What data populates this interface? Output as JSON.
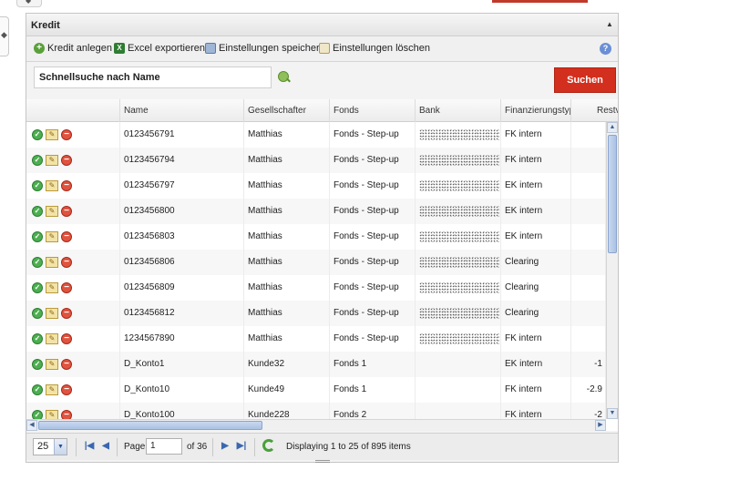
{
  "panel": {
    "title": "Kredit"
  },
  "toolbar": {
    "add_label": "Kredit anlegen",
    "export_label": "Excel exportieren",
    "save_settings_label": "Einstellungen speichern",
    "delete_settings_label": "Einstellungen löschen"
  },
  "search": {
    "value": "Schnellsuche nach Name",
    "button_label": "Suchen"
  },
  "grid": {
    "columns": [
      "",
      "Name",
      "Gesellschafter",
      "Fonds",
      "Bank",
      "Finanzierungstyp",
      "Restv"
    ],
    "rows": [
      {
        "name": "0123456791",
        "gesellschafter": "Matthias",
        "fonds": "Fonds - Step-up",
        "typ": "FK intern",
        "rest": ""
      },
      {
        "name": "0123456794",
        "gesellschafter": "Matthias",
        "fonds": "Fonds - Step-up",
        "typ": "FK intern",
        "rest": ""
      },
      {
        "name": "0123456797",
        "gesellschafter": "Matthias",
        "fonds": "Fonds - Step-up",
        "typ": "EK intern",
        "rest": ""
      },
      {
        "name": "0123456800",
        "gesellschafter": "Matthias",
        "fonds": "Fonds - Step-up",
        "typ": "EK intern",
        "rest": ""
      },
      {
        "name": "0123456803",
        "gesellschafter": "Matthias",
        "fonds": "Fonds - Step-up",
        "typ": "EK intern",
        "rest": ""
      },
      {
        "name": "0123456806",
        "gesellschafter": "Matthias",
        "fonds": "Fonds - Step-up",
        "typ": "Clearing",
        "rest": ""
      },
      {
        "name": "0123456809",
        "gesellschafter": "Matthias",
        "fonds": "Fonds - Step-up",
        "typ": "Clearing",
        "rest": ""
      },
      {
        "name": "0123456812",
        "gesellschafter": "Matthias",
        "fonds": "Fonds - Step-up",
        "typ": "Clearing",
        "rest": ""
      },
      {
        "name": "1234567890",
        "gesellschafter": "Matthias",
        "fonds": "Fonds - Step-up",
        "typ": "FK intern",
        "rest": ""
      },
      {
        "name": "D_Konto1",
        "gesellschafter": "Kunde32",
        "fonds": "Fonds 1",
        "typ": "EK intern",
        "rest": "-1"
      },
      {
        "name": "D_Konto10",
        "gesellschafter": "Kunde49",
        "fonds": "Fonds 1",
        "typ": "FK intern",
        "rest": "-2.9"
      },
      {
        "name": "D_Konto100",
        "gesellschafter": "Kunde228",
        "fonds": "Fonds 2",
        "typ": "FK intern",
        "rest": "-2"
      }
    ]
  },
  "pager": {
    "page_size": "25",
    "page_label": "Page",
    "page_value": "1",
    "page_of": "of 36",
    "display_text": "Displaying 1 to 25 of 895 items"
  }
}
